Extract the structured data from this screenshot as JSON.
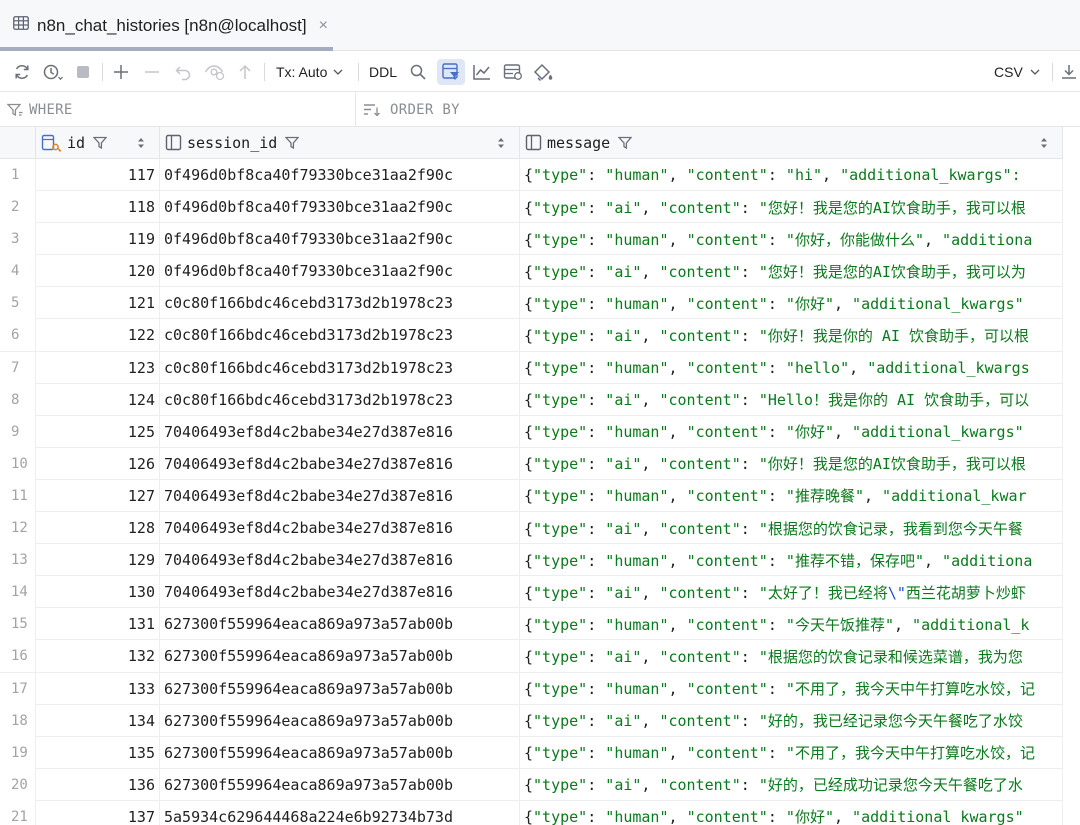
{
  "tab": {
    "title": "n8n_chat_histories [n8n@localhost]",
    "close": "×"
  },
  "toolbar": {
    "tx_mode": "Tx: Auto",
    "ddl": "DDL",
    "export_format": "CSV"
  },
  "filters": {
    "where": "WHERE",
    "order_by": "ORDER BY"
  },
  "columns": [
    {
      "name": "id"
    },
    {
      "name": "session_id"
    },
    {
      "name": "message"
    }
  ],
  "rows": [
    {
      "num": "1",
      "id": "117",
      "session_id": "0f496d0bf8ca40f79330bce31aa2f90c",
      "type": "human",
      "content": "hi",
      "tail": ", \"additional_kwargs\":"
    },
    {
      "num": "2",
      "id": "118",
      "session_id": "0f496d0bf8ca40f79330bce31aa2f90c",
      "type": "ai",
      "content": "您好！我是您的AI饮食助手，我可以根",
      "tail": ""
    },
    {
      "num": "3",
      "id": "119",
      "session_id": "0f496d0bf8ca40f79330bce31aa2f90c",
      "type": "human",
      "content": "你好，你能做什么",
      "tail": ", \"additiona"
    },
    {
      "num": "4",
      "id": "120",
      "session_id": "0f496d0bf8ca40f79330bce31aa2f90c",
      "type": "ai",
      "content": "您好！我是您的AI饮食助手，我可以为",
      "tail": ""
    },
    {
      "num": "5",
      "id": "121",
      "session_id": "c0c80f166bdc46cebd3173d2b1978c23",
      "type": "human",
      "content": "你好",
      "tail": ", \"additional_kwargs\""
    },
    {
      "num": "6",
      "id": "122",
      "session_id": "c0c80f166bdc46cebd3173d2b1978c23",
      "type": "ai",
      "content": "你好！我是你的 AI 饮食助手，可以根",
      "tail": ""
    },
    {
      "num": "7",
      "id": "123",
      "session_id": "c0c80f166bdc46cebd3173d2b1978c23",
      "type": "human",
      "content": "hello",
      "tail": ", \"additional_kwargs"
    },
    {
      "num": "8",
      "id": "124",
      "session_id": "c0c80f166bdc46cebd3173d2b1978c23",
      "type": "ai",
      "content": "Hello！我是你的 AI 饮食助手，可以",
      "tail": ""
    },
    {
      "num": "9",
      "id": "125",
      "session_id": "70406493ef8d4c2babe34e27d387e816",
      "type": "human",
      "content": "你好",
      "tail": ", \"additional_kwargs\""
    },
    {
      "num": "10",
      "id": "126",
      "session_id": "70406493ef8d4c2babe34e27d387e816",
      "type": "ai",
      "content": "你好！我是您的AI饮食助手，我可以根",
      "tail": ""
    },
    {
      "num": "11",
      "id": "127",
      "session_id": "70406493ef8d4c2babe34e27d387e816",
      "type": "human",
      "content": "推荐晚餐",
      "tail": ", \"additional_kwar"
    },
    {
      "num": "12",
      "id": "128",
      "session_id": "70406493ef8d4c2babe34e27d387e816",
      "type": "ai",
      "content": "根据您的饮食记录，我看到您今天午餐",
      "tail": ""
    },
    {
      "num": "13",
      "id": "129",
      "session_id": "70406493ef8d4c2babe34e27d387e816",
      "type": "human",
      "content": "推荐不错，保存吧",
      "tail": ", \"additiona"
    },
    {
      "num": "14",
      "id": "130",
      "session_id": "70406493ef8d4c2babe34e27d387e816",
      "type": "ai",
      "content": "太好了！我已经将",
      "escape": "\\\"",
      "content2": "西兰花胡萝卜炒虾",
      "tail": ""
    },
    {
      "num": "15",
      "id": "131",
      "session_id": "627300f559964eaca869a973a57ab00b",
      "type": "human",
      "content": "今天午饭推荐",
      "tail": ", \"additional_k"
    },
    {
      "num": "16",
      "id": "132",
      "session_id": "627300f559964eaca869a973a57ab00b",
      "type": "ai",
      "content": "根据您的饮食记录和候选菜谱，我为您",
      "tail": ""
    },
    {
      "num": "17",
      "id": "133",
      "session_id": "627300f559964eaca869a973a57ab00b",
      "type": "human",
      "content": "不用了，我今天中午打算吃水饺，记",
      "tail": ""
    },
    {
      "num": "18",
      "id": "134",
      "session_id": "627300f559964eaca869a973a57ab00b",
      "type": "ai",
      "content": "好的，我已经记录您今天午餐吃了水饺",
      "tail": ""
    },
    {
      "num": "19",
      "id": "135",
      "session_id": "627300f559964eaca869a973a57ab00b",
      "type": "human",
      "content": "不用了，我今天中午打算吃水饺，记",
      "tail": ""
    },
    {
      "num": "20",
      "id": "136",
      "session_id": "627300f559964eaca869a973a57ab00b",
      "type": "ai",
      "content": "好的，已经成功记录您今天午餐吃了水",
      "tail": ""
    },
    {
      "num": "21",
      "id": "137",
      "session_id": "5a5934c629644468a224e6b92734b73d",
      "type": "human",
      "content": "你好",
      "tail": ", \"additional_kwargs\""
    }
  ],
  "colors": {
    "string": "#0a7a1c",
    "escape": "#1a4fd6",
    "active_tool_bg": "#dfe6f5"
  }
}
